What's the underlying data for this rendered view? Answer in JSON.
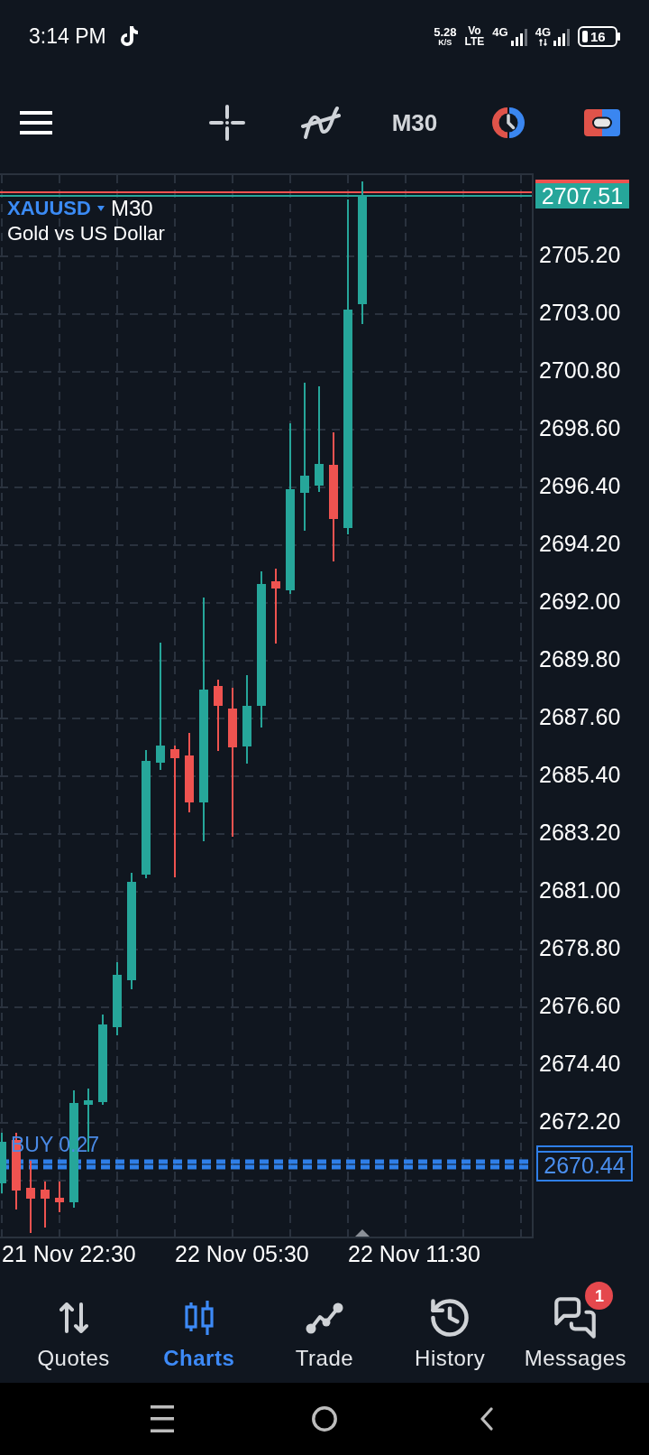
{
  "status_bar": {
    "time": "3:14 PM",
    "net_speed": "5.28",
    "net_speed_unit": "K/S",
    "volte": [
      "Vo",
      "LTE"
    ],
    "sims": [
      {
        "network": "4G",
        "data_active": false
      },
      {
        "network": "4G",
        "data_active": true
      }
    ],
    "battery": "16"
  },
  "toolbar": {
    "timeframe": "M30"
  },
  "chart": {
    "symbol": "XAUUSD",
    "timeframe": "M30",
    "description": "Gold vs US Dollar",
    "current_price": "2707.51",
    "price_axis": [
      "2705.20",
      "2703.00",
      "2700.80",
      "2698.60",
      "2696.40",
      "2694.20",
      "2692.00",
      "2689.80",
      "2687.60",
      "2685.40",
      "2683.20",
      "2681.00",
      "2678.80",
      "2676.60",
      "2674.40",
      "2672.20"
    ],
    "time_axis": [
      "21 Nov 22:30",
      "22 Nov 05:30",
      "22 Nov 11:30"
    ],
    "position": {
      "label": "BUY 0.27",
      "price": "2670.44"
    }
  },
  "bottom_nav": [
    {
      "label": "Quotes",
      "selected": false
    },
    {
      "label": "Charts",
      "selected": true
    },
    {
      "label": "Trade",
      "selected": false
    },
    {
      "label": "History",
      "selected": false
    },
    {
      "label": "Messages",
      "selected": false,
      "badge": "1"
    }
  ]
}
